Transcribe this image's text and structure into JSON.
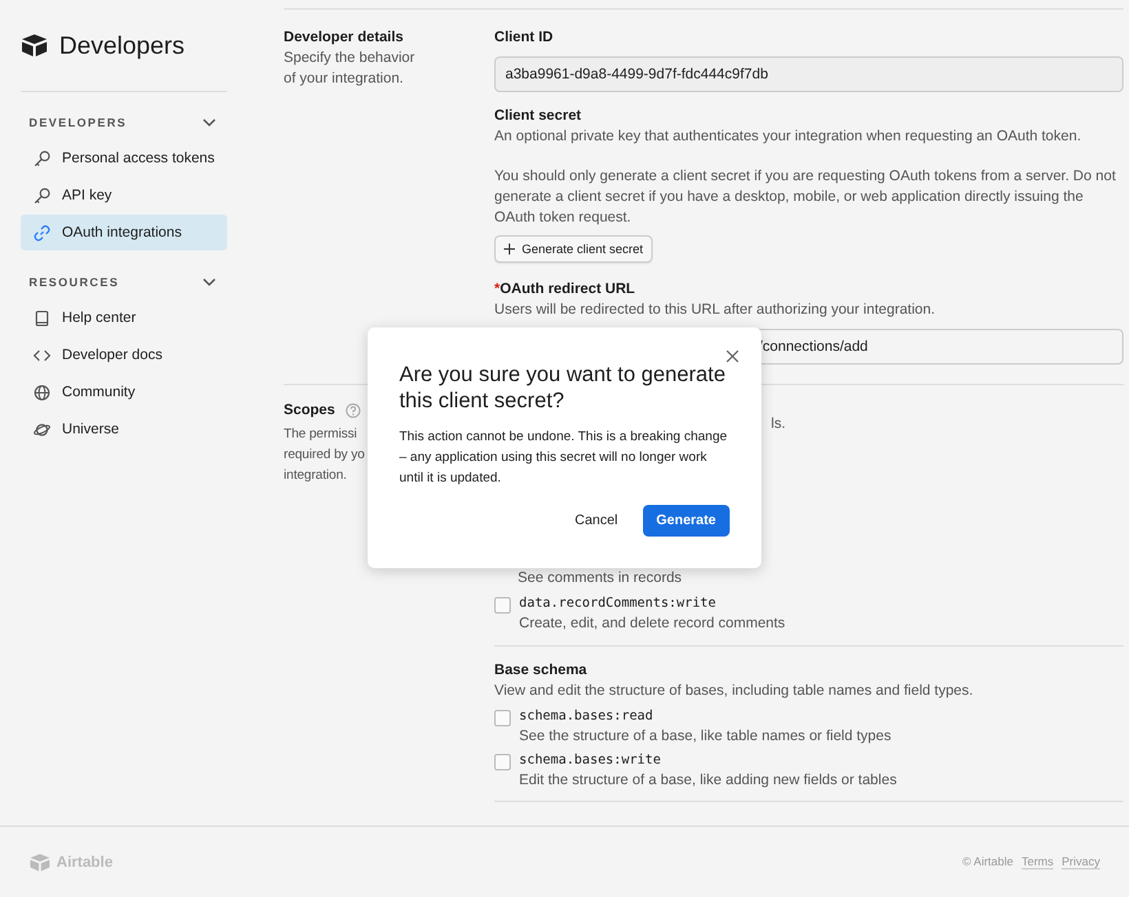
{
  "sidebar": {
    "title": "Developers",
    "sections": [
      {
        "heading": "DEVELOPERS",
        "expanded": true,
        "items": [
          {
            "label": "Personal access tokens",
            "kind": "key",
            "selected": false
          },
          {
            "label": "API key",
            "kind": "key",
            "selected": false
          },
          {
            "label": "OAuth integrations",
            "kind": "link",
            "selected": true
          }
        ]
      },
      {
        "heading": "RESOURCES",
        "expanded": true,
        "items": [
          {
            "label": "Help center",
            "kind": "book",
            "selected": false
          },
          {
            "label": "Developer docs",
            "kind": "code",
            "selected": false
          },
          {
            "label": "Community",
            "kind": "globe",
            "selected": false
          },
          {
            "label": "Universe",
            "kind": "planet",
            "selected": false
          }
        ]
      }
    ]
  },
  "details": {
    "heading": "Developer details",
    "description": "Specify the behavior of your integration.",
    "client_id": {
      "label": "Client ID",
      "value": "a3ba9961-d9a8-4499-9d7f-fdc444c9f7db"
    },
    "client_secret": {
      "label": "Client secret",
      "description": "An optional private key that authenticates your integration when requesting an OAuth token.",
      "note": "You should only generate a client secret if you are requesting OAuth tokens from a server. Do not generate a client secret if you have a desktop, mobile, or web application directly issuing the OAuth token request.",
      "button": "Generate client secret"
    },
    "redirect_url": {
      "label": "OAuth redirect URL",
      "required": true,
      "required_mark": "*",
      "description": "Users will be redirected to this URL after authorizing your integration.",
      "value": "/connections/add"
    }
  },
  "scopes": {
    "heading": "Scopes",
    "description_lines": [
      "The permissi",
      "required by yo",
      "integration."
    ],
    "description_tail": "ls.",
    "items": [
      {
        "kind": "partial",
        "description": "See comments in records"
      },
      {
        "kind": "row",
        "name": "data.recordComments:write",
        "description": "Create, edit, and delete record comments",
        "checked": false
      }
    ],
    "groups": [
      {
        "heading": "Base schema",
        "description": "View and edit the structure of bases, including table names and field types.",
        "items": [
          {
            "name": "schema.bases:read",
            "description": "See the structure of a base, like table names or field types",
            "checked": false
          },
          {
            "name": "schema.bases:write",
            "description": "Edit the structure of a base, like adding new fields or tables",
            "checked": false
          }
        ]
      }
    ]
  },
  "dialog": {
    "title": "Are you sure you want to generate this client secret?",
    "body": "This action cannot be undone. This is a breaking change – any application using this secret will no longer work until it is updated.",
    "cancel": "Cancel",
    "confirm": "Generate"
  },
  "footer": {
    "logo": "Airtable",
    "copyright": "© Airtable",
    "links": [
      "Terms",
      "Privacy"
    ]
  }
}
